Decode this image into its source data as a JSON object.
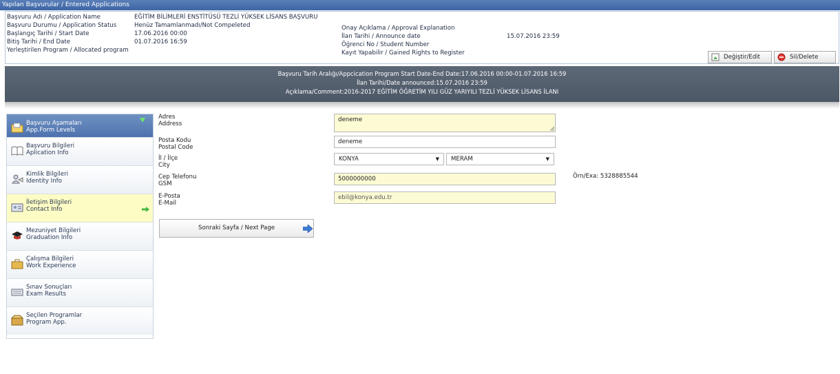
{
  "header": {
    "title": "Yapılan Başvurular / Entered Applications"
  },
  "info": {
    "left_labels": [
      "Başvuru Adı / Application Name",
      "Başvuru Durumu / Application Status",
      "Başlangıç Tarihi / Start Date",
      "Bitiş Tarihi / End Date",
      "Yerleştirilen Program / Allocated program"
    ],
    "left_values": [
      "EĞİTİM BİLİMLERİ ENSTİTÜSÜ TEZLİ YÜKSEK LİSANS BAŞVURU",
      "Henüz Tamamlanmadı/Not Compeleted",
      "17.06.2016 00:00",
      "01.07.2016 16:59"
    ],
    "right_labels": [
      "Onay Açıklama / Approval Explanation",
      "İlan Tarihi / Announce date",
      "Öğrenci No / Student Number",
      "Kayıt Yapabilir / Gained Rights to Register"
    ],
    "announce_value": "15.07.2016 23:59"
  },
  "buttons": {
    "edit": "Değiştir/Edit",
    "delete": "Sil/Delete"
  },
  "banner": {
    "line1": "Başvuru Tarih Aralığı/Appcication Program Start Date-End Date:17.06.2016 00:00-01.07.2016 16:59",
    "line2": "İlan Tarihi/Date announced:15.07.2016 23:59",
    "line3": "Açıklama/Comment:2016-2017 EĞİTİM ÖĞRETİM YILI GÜZ YARIYILI TEZLİ YÜKSEK LİSANS İLANI"
  },
  "sidebar": {
    "header": {
      "line1": "Başvuru Aşamaları",
      "line2": "App.Form Levels"
    },
    "items": [
      {
        "line1": "Başvuru Bilgileri",
        "line2": "Aplication Info"
      },
      {
        "line1": "Kimlik Bilgileri",
        "line2": "Identity Info"
      },
      {
        "line1": "İletişim Bilgileri",
        "line2": "Contact Info"
      },
      {
        "line1": "Mezuniyet Bilgileri",
        "line2": "Graduation Info"
      },
      {
        "line1": "Çalışma Bilgileri",
        "line2": "Work Experience"
      },
      {
        "line1": "Sınav Sonuçları",
        "line2": "Exam Results"
      },
      {
        "line1": "Seçilen Programlar",
        "line2": "Program App."
      }
    ],
    "active_index": 2
  },
  "form": {
    "address": {
      "label1": "Adres",
      "label2": "Address",
      "value": "deneme"
    },
    "postal": {
      "label1": "Posta Kodu",
      "label2": "Postal Code",
      "value": "deneme"
    },
    "city": {
      "label1": "İl / İlçe",
      "label2": "City",
      "province": "KONYA",
      "district": "MERAM"
    },
    "gsm": {
      "label1": "Cep Telefonu",
      "label2": "GSM",
      "value": "5000000000",
      "example": "Örn/Exa: 5328885544"
    },
    "email": {
      "label1": "E-Posta",
      "label2": "E-Mail",
      "value": "ebil@konya.edu.tr"
    }
  },
  "next_button": "Sonraki Sayfa / Next Page",
  "colors": {
    "header_blue": "#4a70ad",
    "banner_gray": "#56606f",
    "field_yellow": "#fdfbd4",
    "active_item": "#fdfcc4"
  }
}
